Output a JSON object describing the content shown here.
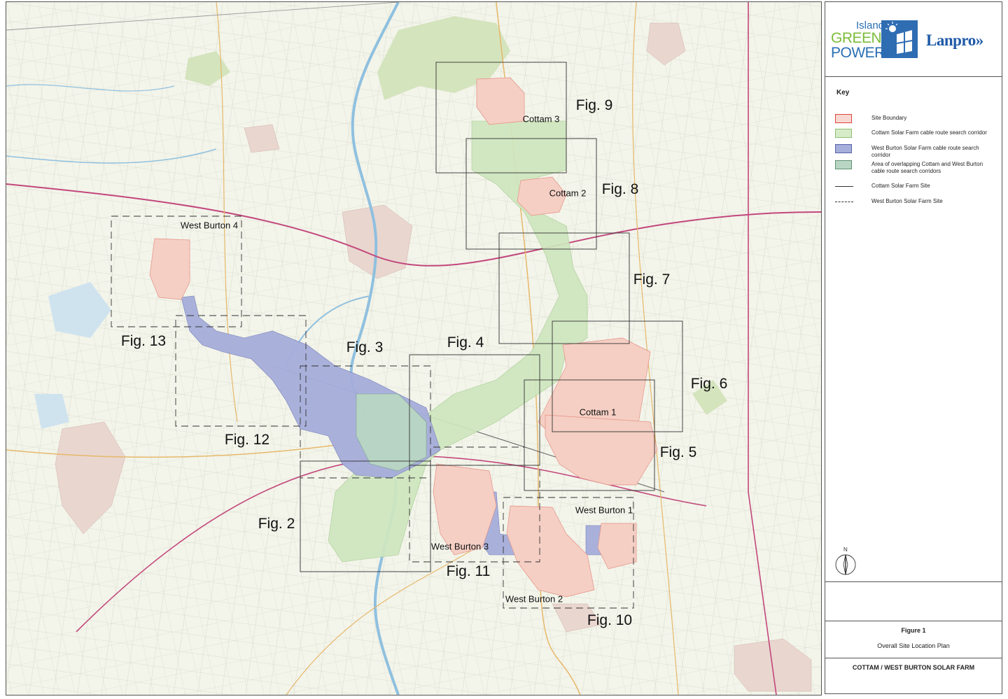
{
  "map": {
    "figure_labels": [
      {
        "id": "fig9",
        "text": "Fig. 9"
      },
      {
        "id": "fig8",
        "text": "Fig. 8"
      },
      {
        "id": "fig7",
        "text": "Fig. 7"
      },
      {
        "id": "fig6",
        "text": "Fig. 6"
      },
      {
        "id": "fig5",
        "text": "Fig. 5"
      },
      {
        "id": "fig4",
        "text": "Fig. 4"
      },
      {
        "id": "fig3",
        "text": "Fig. 3"
      },
      {
        "id": "fig2",
        "text": "Fig. 2"
      },
      {
        "id": "fig10",
        "text": "Fig. 10"
      },
      {
        "id": "fig11",
        "text": "Fig. 11"
      },
      {
        "id": "fig12",
        "text": "Fig. 12"
      },
      {
        "id": "fig13",
        "text": "Fig. 13"
      }
    ],
    "site_labels": [
      {
        "id": "cottam3",
        "text": "Cottam 3"
      },
      {
        "id": "cottam2",
        "text": "Cottam 2"
      },
      {
        "id": "cottam1",
        "text": "Cottam 1"
      },
      {
        "id": "wb4",
        "text": "West Burton 4"
      },
      {
        "id": "wb3",
        "text": "West Burton 3"
      },
      {
        "id": "wb1",
        "text": "West Burton 1"
      },
      {
        "id": "wb2",
        "text": "West Burton 2"
      }
    ]
  },
  "logos": {
    "island": "Island",
    "green": "GREEN",
    "power": "POWER",
    "lanpro": "Lanpro»"
  },
  "key": {
    "title": "Key",
    "items": [
      {
        "label": "Site Boundary",
        "swatch": "#f7d9d2",
        "border": "#e0413a"
      },
      {
        "label": "Cottam Solar Farm cable route search corridor",
        "swatch": "#d6ebc8",
        "border": "#8cbf74"
      },
      {
        "label": "West Burton Solar Farm cable route search corridor",
        "swatch": "#a6aedb",
        "border": "#5861a8"
      },
      {
        "label": "Area of overlapping Cottam and West Burton cable route search corridors",
        "swatch": "#b9d6c4",
        "border": "#5e8f72"
      },
      {
        "label": "Cottam Solar Farm Site"
      },
      {
        "label": "West Burton Solar Farm Site"
      }
    ],
    "north": "N"
  },
  "title_block": {
    "figure_number": "Figure 1",
    "figure_title": "Overall Site Location Plan",
    "project": "COTTAM / WEST BURTON SOLAR FARM"
  },
  "colors": {
    "site_boundary": "#f2c4b8",
    "cottam_corridor": "#cfe6bf",
    "west_burton_corridor": "#9fa6d8",
    "river": "#9cc7e2",
    "road_major": "#c2477c",
    "road_minor": "#e6b86a",
    "woodland": "#cfe0b4"
  }
}
